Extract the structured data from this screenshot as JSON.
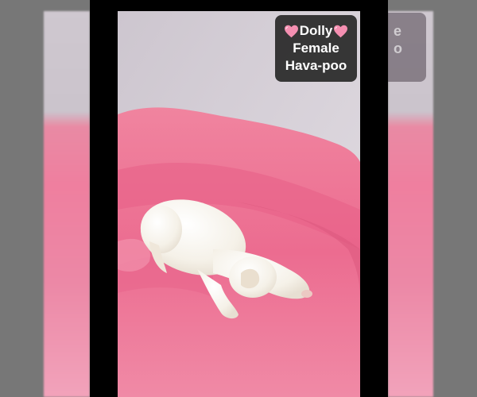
{
  "overlay": {
    "name": "Dolly",
    "sex": "Female",
    "breed": "Hava-poo",
    "heart_icon": "pink-heart-icon",
    "heart_color": "#f48fb1"
  },
  "colors": {
    "blanket": "#ee6b8f",
    "wall": "#d6d0d8",
    "puppy": "#f8f5ee",
    "frame": "#000000"
  }
}
